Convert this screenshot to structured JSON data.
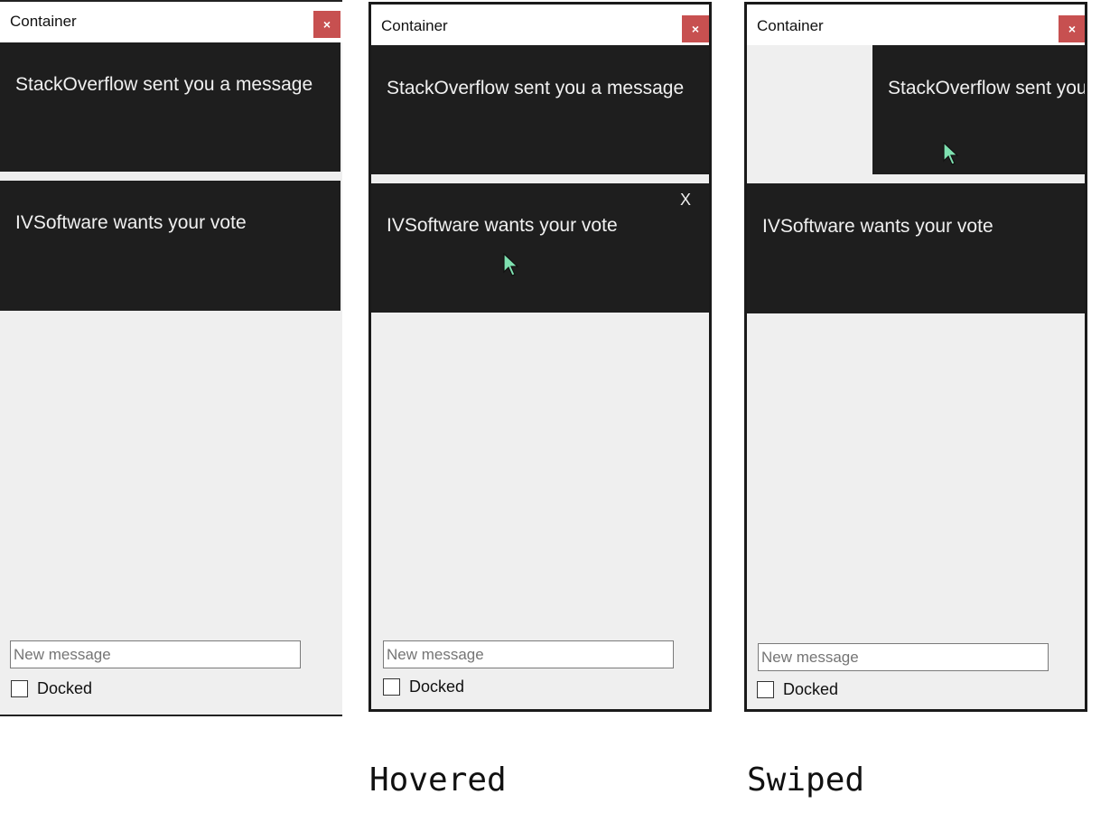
{
  "panels": [
    {
      "state": "default",
      "title": "Container",
      "close_label": "×",
      "notifications": [
        {
          "text": "StackOverflow sent you a message"
        },
        {
          "text": "IVSoftware wants your vote"
        }
      ],
      "input_placeholder": "New message",
      "input_value": "",
      "checkbox_label": "Docked",
      "checkbox_checked": false,
      "caption": ""
    },
    {
      "state": "hovered",
      "title": "Container",
      "close_label": "×",
      "notifications": [
        {
          "text": "StackOverflow sent you a message"
        },
        {
          "text": "IVSoftware wants your vote",
          "dismiss_label": "X"
        }
      ],
      "input_placeholder": "New message",
      "input_value": "",
      "checkbox_label": "Docked",
      "checkbox_checked": false,
      "caption": "Hovered"
    },
    {
      "state": "swiped",
      "title": "Container",
      "close_label": "×",
      "notifications": [
        {
          "text": "StackOverflow sent you a message"
        },
        {
          "text": "IVSoftware wants your vote"
        }
      ],
      "input_placeholder": "New message",
      "input_value": "",
      "checkbox_label": "Docked",
      "checkbox_checked": false,
      "caption": "Swiped"
    }
  ],
  "colors": {
    "card_bg": "#1e1e1e",
    "panel_bg": "#efefef",
    "close_bg": "#c75050",
    "cursor": "#7ee0b0"
  }
}
